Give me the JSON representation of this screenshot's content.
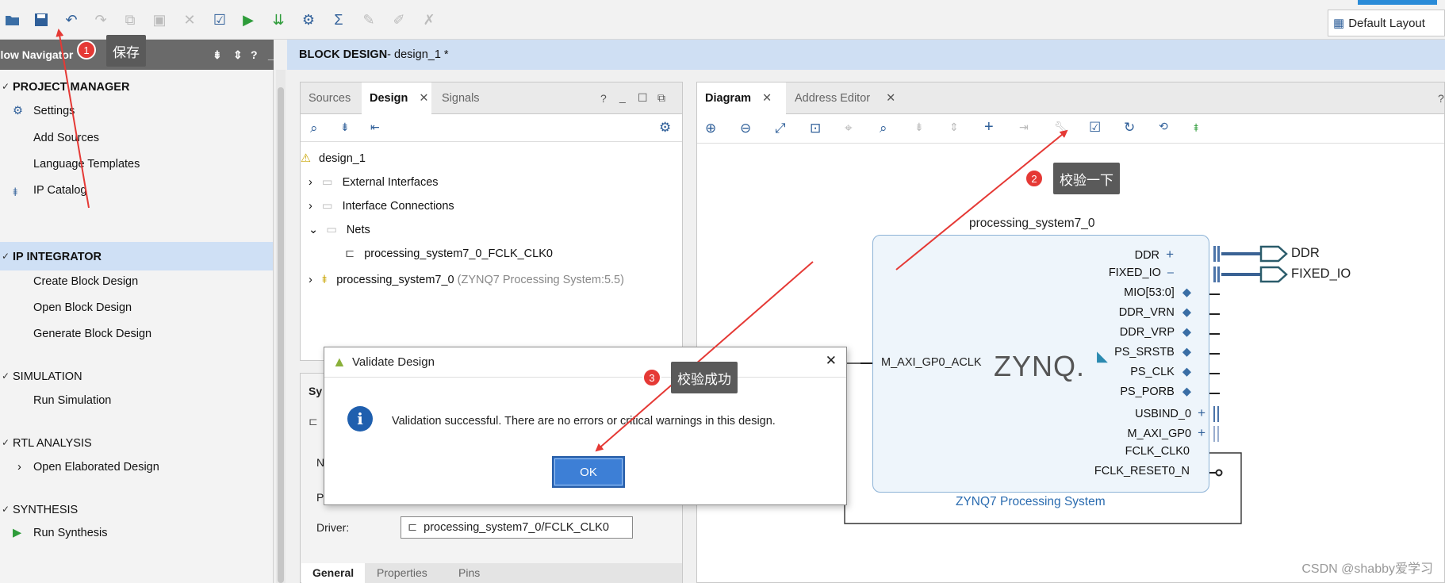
{
  "toolbar": {
    "layout_label": "Default Layout",
    "icons": [
      "open-icon",
      "save-icon",
      "undo-icon",
      "redo-icon",
      "copy-icon",
      "paste-icon",
      "delete-icon",
      "validate-icon",
      "run-icon",
      "download-icon",
      "settings-icon",
      "sigma-icon",
      "tool-a-icon",
      "tool-b-icon",
      "tool-c-icon"
    ]
  },
  "flow_nav": {
    "title": "Flow Navigator",
    "sections": {
      "project_manager": "PROJECT MANAGER",
      "pm_settings": "Settings",
      "pm_add_sources": "Add Sources",
      "pm_language_templates": "Language Templates",
      "pm_ip_catalog": "IP Catalog",
      "ip_integrator": "IP INTEGRATOR",
      "ipi_create": "Create Block Design",
      "ipi_open": "Open Block Design",
      "ipi_generate": "Generate Block Design",
      "simulation": "SIMULATION",
      "sim_run": "Run Simulation",
      "rtl_analysis": "RTL ANALYSIS",
      "rtl_open": "Open Elaborated Design",
      "synthesis": "SYNTHESIS",
      "syn_run": "Run Synthesis"
    }
  },
  "block_design": {
    "header_prefix": "BLOCK DESIGN",
    "header_name": " - design_1 *"
  },
  "design_panel": {
    "tabs": [
      "Sources",
      "Design",
      "Signals"
    ],
    "active_tab": "Design",
    "tree": {
      "root": "design_1",
      "external_interfaces": "External Interfaces",
      "interface_connections": "Interface Connections",
      "nets": "Nets",
      "net_fclk": "processing_system7_0_FCLK_CLK0",
      "ps_name": "processing_system7_0",
      "ps_detail": " (ZYNQ7 Processing System:5.5)"
    }
  },
  "props_panel": {
    "title_fragment": "Sy",
    "name_label": "N",
    "parent_label": "P",
    "driver_label": "Driver:",
    "driver_value": "processing_system7_0/FCLK_CLK0",
    "tabs": [
      "General",
      "Properties",
      "Pins"
    ]
  },
  "diagram_panel": {
    "tabs": [
      "Diagram",
      "Address Editor"
    ],
    "active_tab": "Diagram",
    "block_title": "processing_system7_0",
    "block_subtitle": "ZYNQ7 Processing System",
    "logo_text": "ZYNQ.",
    "left_port": "M_AXI_GP0_ACLK",
    "right_ports": [
      "DDR",
      "FIXED_IO",
      "MIO[53:0]",
      "DDR_VRN",
      "DDR_VRP",
      "PS_SRSTB",
      "PS_CLK",
      "PS_PORB",
      "USBIND_0",
      "M_AXI_GP0",
      "FCLK_CLK0",
      "FCLK_RESET0_N"
    ],
    "external_ports": [
      "DDR",
      "FIXED_IO"
    ]
  },
  "dialog": {
    "title": "Validate Design",
    "message": "Validation successful. There are no errors or critical warnings in this design.",
    "ok_label": "OK",
    "close_label": "✕"
  },
  "annotations": [
    {
      "number": "1",
      "text": "保存"
    },
    {
      "number": "2",
      "text": "校验一下"
    },
    {
      "number": "3",
      "text": "校验成功"
    }
  ],
  "watermark": "CSDN @shabby爱学习",
  "colors": {
    "accent_blue": "#3d7fd6",
    "callout_bg": "#5a5a5a",
    "badge_red": "#e53935",
    "arrow_red": "#e53935",
    "block_fill": "#eef5fb"
  }
}
